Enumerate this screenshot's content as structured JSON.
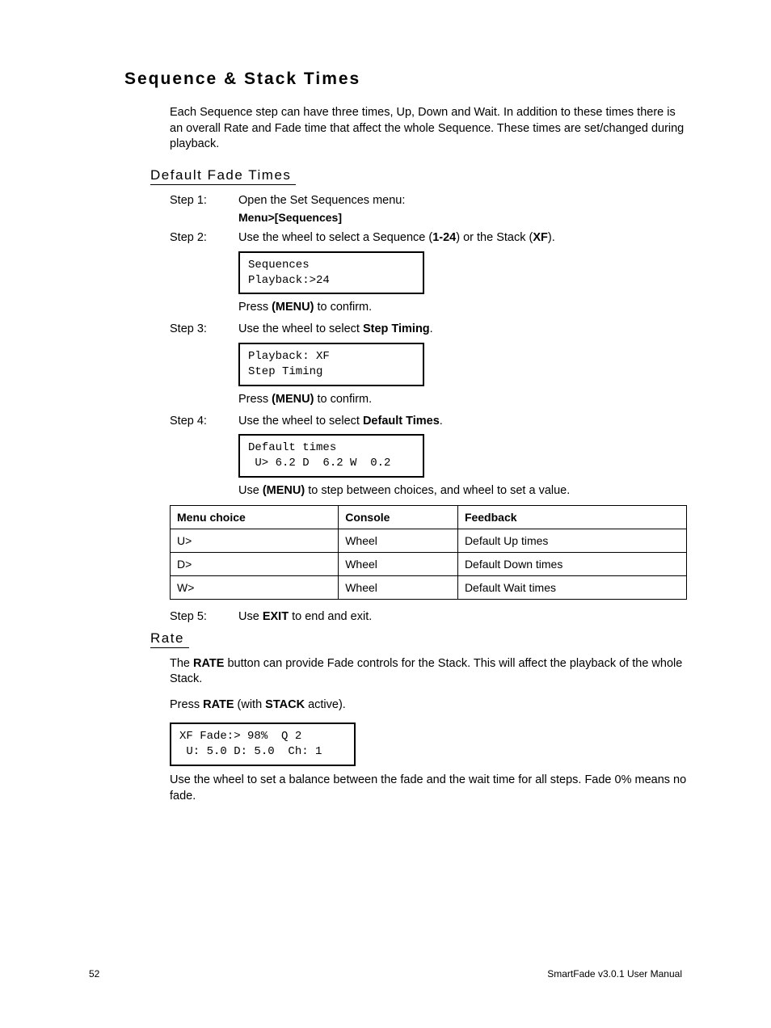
{
  "title": "Sequence & Stack Times",
  "intro": "Each Sequence step can have three times, Up, Down and Wait. In addition to these times there is an overall Rate and Fade time that affect the whole Sequence. These times are set/changed during playback.",
  "subheads": {
    "default_fade": "Default Fade Times",
    "rate": "Rate"
  },
  "steps": {
    "s1_label": "Step 1:",
    "s1_text": "Open the Set Sequences menu:",
    "s1_path_a": "Menu",
    "s1_path_sep": ">",
    "s1_path_b": "[Sequences]",
    "s2_label": "Step 2:",
    "s2_pre": "Use the wheel to select a Sequence (",
    "s2_bold1": "1-24",
    "s2_mid": ") or the Stack (",
    "s2_bold2": "XF",
    "s2_post": ").",
    "s3_label": "Step 3:",
    "s3_pre": "Use the wheel to select ",
    "s3_bold": "Step Timing",
    "s3_post": ".",
    "s4_label": "Step 4:",
    "s4_pre": "Use the wheel to select ",
    "s4_bold": "Default Times",
    "s4_post": ".",
    "s5_label": "Step 5:",
    "s5_pre": "Use ",
    "s5_bold": "EXIT",
    "s5_post": " to end and exit."
  },
  "confirm": {
    "press": "Press ",
    "menu": "(MENU)",
    "to_confirm": " to confirm.",
    "use": "Use ",
    "step_between": " to step between choices, and wheel to set a value."
  },
  "lcd": {
    "box1": "Sequences\nPlayback:>24",
    "box2": "Playback: XF\nStep Timing",
    "box3": "Default times\n U> 6.2 D  6.2 W  0.2",
    "box4": "XF Fade:> 98%  Q 2\n U: 5.0 D: 5.0  Ch: 1"
  },
  "table": {
    "headers": [
      "Menu choice",
      "Console",
      "Feedback"
    ],
    "rows": [
      [
        "U>",
        "Wheel",
        "Default Up times"
      ],
      [
        "D>",
        "Wheel",
        "Default Down times"
      ],
      [
        "W>",
        "Wheel",
        "Default Wait times"
      ]
    ]
  },
  "rate": {
    "p1_pre": "The ",
    "p1_bold": "RATE",
    "p1_post": " button can provide Fade controls for the Stack. This will affect the playback of the whole Stack.",
    "p2_press": "Press ",
    "p2_rate": "RATE",
    "p2_mid": " (with ",
    "p2_stack": "STACK",
    "p2_post": " active).",
    "p3": "Use the wheel to set a balance between the fade and the wait time for all steps. Fade 0% means no fade."
  },
  "footer": {
    "page": "52",
    "doc": "SmartFade v3.0.1 User Manual"
  }
}
